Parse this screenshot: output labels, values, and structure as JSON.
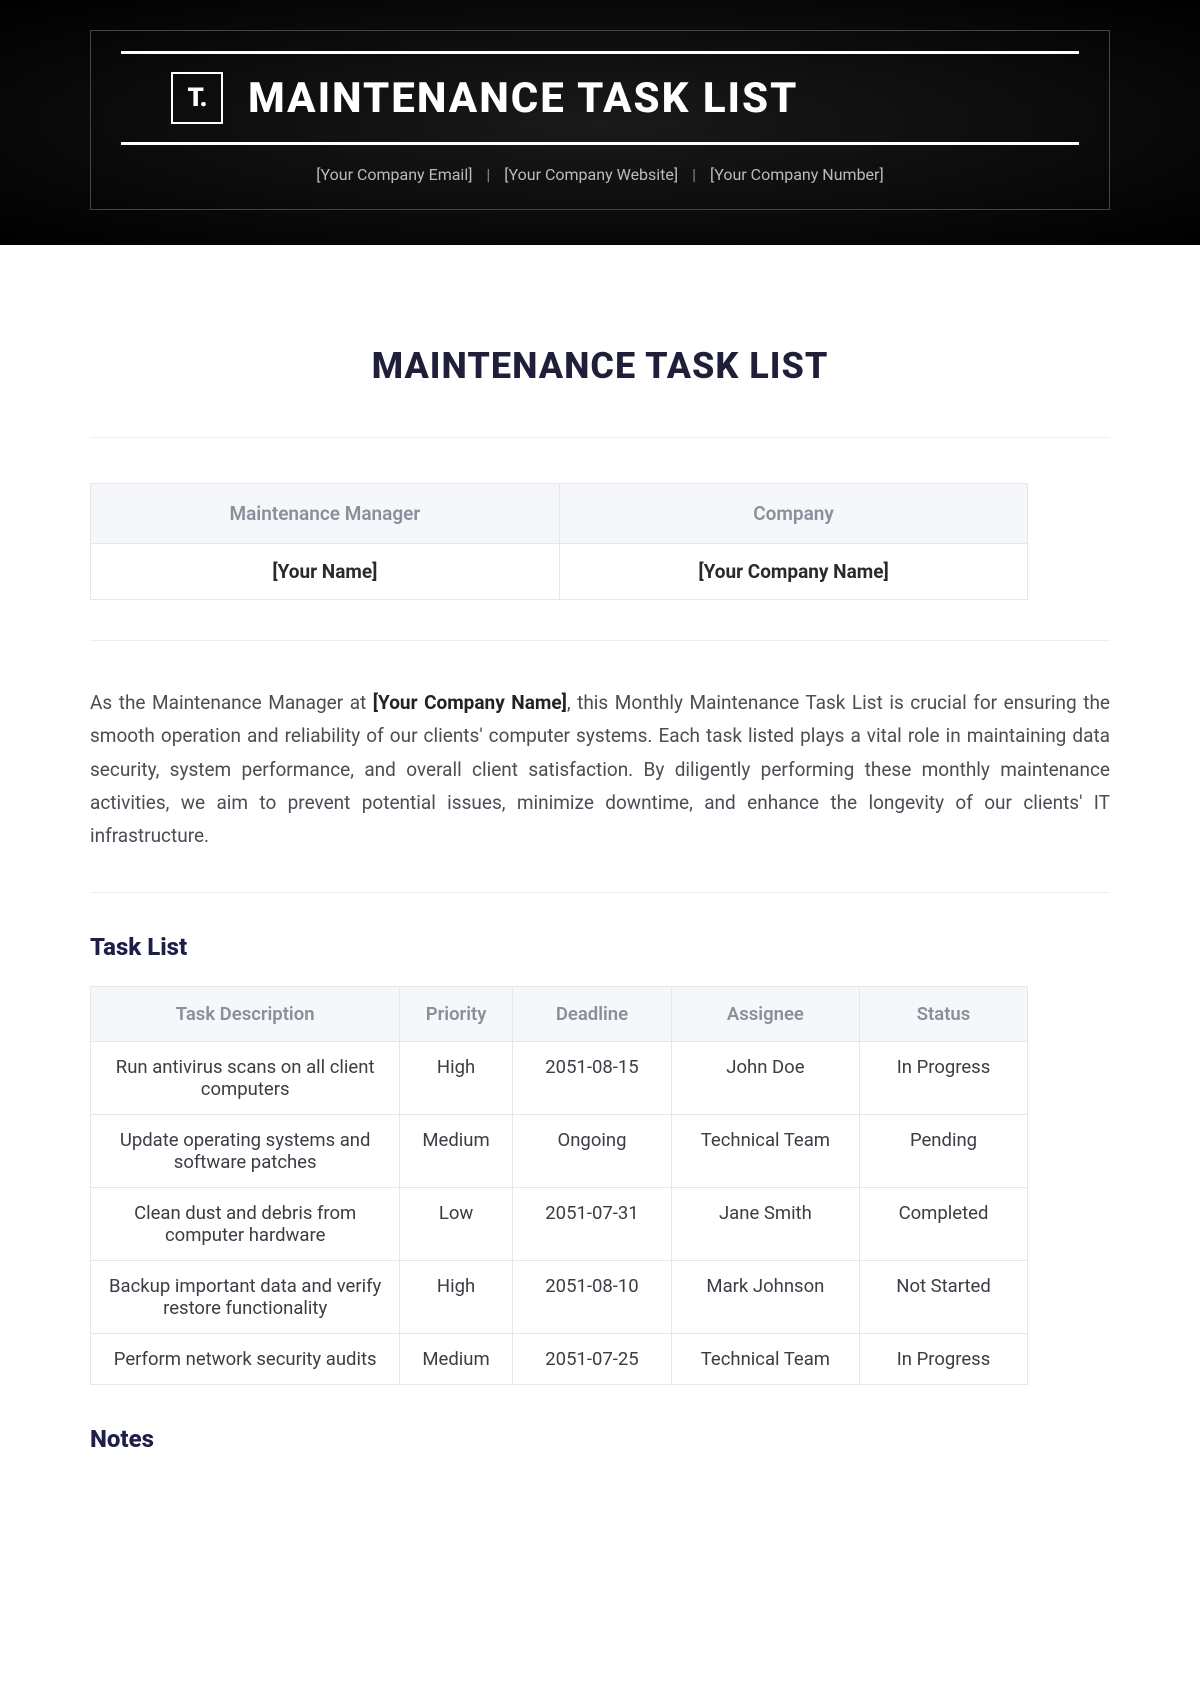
{
  "banner": {
    "logo": "T.",
    "title": "MAINTENANCE TASK LIST",
    "contacts": {
      "email": "[Your Company Email]",
      "website": "[Your Company Website]",
      "number": "[Your Company Number]"
    }
  },
  "page_title": "MAINTENANCE TASK LIST",
  "info_table": {
    "headers": {
      "manager": "Maintenance Manager",
      "company": "Company"
    },
    "values": {
      "manager": "[Your Name]",
      "company": "[Your Company Name]"
    }
  },
  "intro": {
    "pre": "As the Maintenance Manager at ",
    "company_bold": "[Your Company Name]",
    "post": ", this Monthly Maintenance Task List is crucial for ensuring the smooth operation and reliability of our clients' computer systems. Each task listed plays a vital role in maintaining data security, system performance, and overall client satisfaction. By diligently performing these monthly maintenance activities, we aim to prevent potential issues, minimize downtime, and enhance the longevity of our clients' IT infrastructure."
  },
  "section_task_list": "Task List",
  "task_headers": {
    "desc": "Task Description",
    "priority": "Priority",
    "deadline": "Deadline",
    "assignee": "Assignee",
    "status": "Status"
  },
  "tasks": [
    {
      "desc": "Run antivirus scans on all client computers",
      "priority": "High",
      "deadline": "2051-08-15",
      "assignee": "John Doe",
      "status": "In Progress"
    },
    {
      "desc": "Update operating systems and software patches",
      "priority": "Medium",
      "deadline": "Ongoing",
      "assignee": "Technical Team",
      "status": "Pending"
    },
    {
      "desc": "Clean dust and debris from computer hardware",
      "priority": "Low",
      "deadline": "2051-07-31",
      "assignee": "Jane Smith",
      "status": "Completed"
    },
    {
      "desc": "Backup important data and verify restore functionality",
      "priority": "High",
      "deadline": "2051-08-10",
      "assignee": "Mark Johnson",
      "status": "Not Started"
    },
    {
      "desc": "Perform network security audits",
      "priority": "Medium",
      "deadline": "2051-07-25",
      "assignee": "Technical Team",
      "status": "In Progress"
    }
  ],
  "section_notes": "Notes"
}
